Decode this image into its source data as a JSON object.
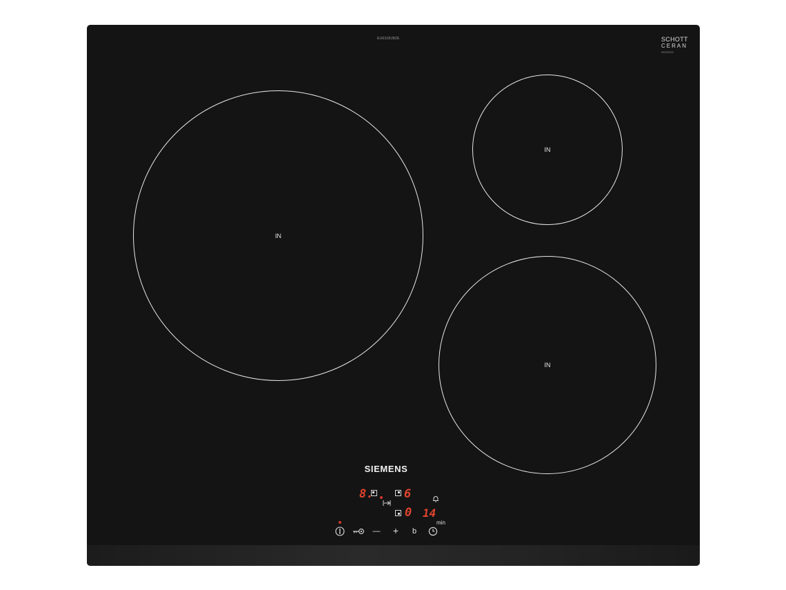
{
  "hob": {
    "model_number": "EU631BJB2E",
    "glass_brand": {
      "line1": "SCHOTT",
      "line2": "CERAN",
      "code": "96029330"
    },
    "brand": "SIEMENS",
    "zones": [
      {
        "id": "large-left",
        "label": "IN"
      },
      {
        "id": "small-top-right",
        "label": "IN"
      },
      {
        "id": "medium-bottom-right",
        "label": "IN"
      }
    ],
    "display": {
      "zone_left_level": "8.",
      "zone_right_level": "6",
      "timer_zone_value": "0",
      "timer_minutes": "14",
      "timer_unit": "min"
    },
    "controls": [
      {
        "name": "power-button",
        "icon": "power-icon"
      },
      {
        "name": "child-lock-button",
        "icon": "key-icon"
      },
      {
        "name": "minus-button",
        "icon": "minus-icon",
        "label": "—"
      },
      {
        "name": "plus-button",
        "icon": "plus-icon",
        "label": "+"
      },
      {
        "name": "boost-button",
        "icon": "boost-icon",
        "label": "b"
      },
      {
        "name": "timer-button",
        "icon": "clock-icon"
      }
    ],
    "indicator_color": "#d4382a",
    "display_color": "#e0442e"
  }
}
